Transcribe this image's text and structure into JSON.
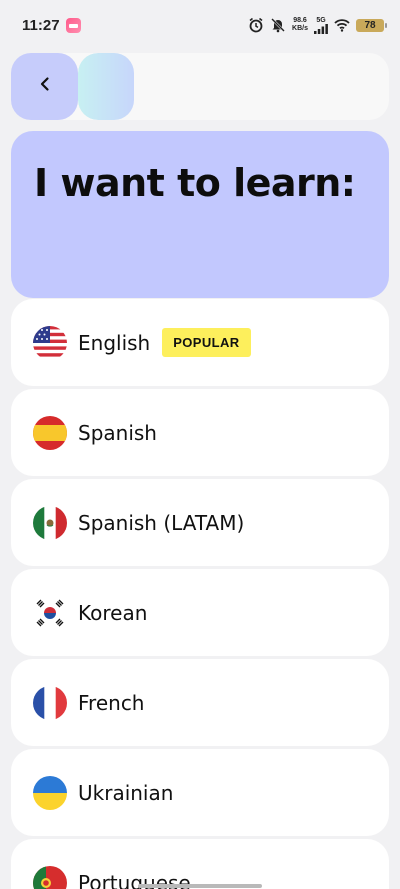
{
  "status_bar": {
    "time": "11:27",
    "net_speed_value": "98.6",
    "net_speed_unit": "KB/s",
    "network_type": "5G",
    "battery": "78"
  },
  "header": {
    "title": "I want to learn:"
  },
  "progress": {
    "fraction": 0.18
  },
  "languages": [
    {
      "label": "English",
      "badge": "POPULAR",
      "flag": "us-flag-icon"
    },
    {
      "label": "Spanish",
      "flag": "spain-flag-icon"
    },
    {
      "label": "Spanish (LATAM)",
      "flag": "mexico-flag-icon"
    },
    {
      "label": "Korean",
      "flag": "south-korea-flag-icon"
    },
    {
      "label": "French",
      "flag": "france-flag-icon"
    },
    {
      "label": "Ukrainian",
      "flag": "ukraine-flag-icon"
    },
    {
      "label": "Portuguese",
      "flag": "portugal-flag-icon"
    }
  ],
  "colors": {
    "accent": "#c2c8fe",
    "badge": "#fdef5c",
    "background": "#f1f1f3"
  }
}
